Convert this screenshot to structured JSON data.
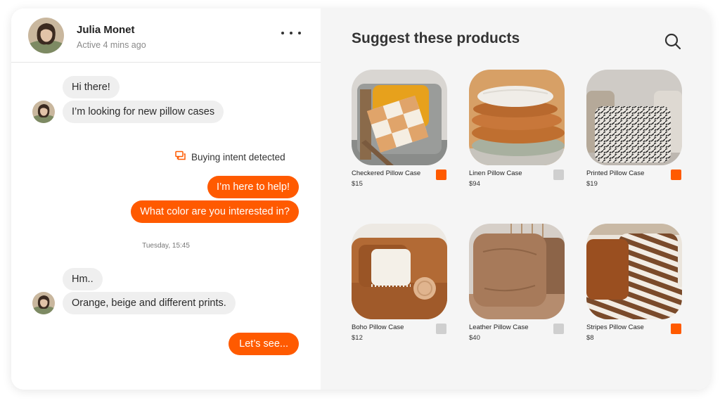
{
  "contact": {
    "name": "Julia Monet",
    "status": "Active 4 mins ago"
  },
  "messages": [
    {
      "from": "customer",
      "text": "Hi there!"
    },
    {
      "from": "customer",
      "text": "I’m looking for new pillow cases"
    },
    {
      "from": "agent",
      "text": "I’m here to help!"
    },
    {
      "from": "agent",
      "text": "What color are you interested in?"
    },
    {
      "from": "customer",
      "text": "Hm.."
    },
    {
      "from": "customer",
      "text": "Orange, beige and different prints."
    },
    {
      "from": "agent",
      "text": "Let’s see..."
    }
  ],
  "intent_label": "Buying intent detected",
  "timestamp": "Tuesday, 15:45",
  "panel": {
    "title": "Suggest these products"
  },
  "products": [
    {
      "name": "Checkered Pillow Case",
      "price": "$15",
      "swatch": "#ff5a00"
    },
    {
      "name": "Linen Pillow Case",
      "price": "$94",
      "swatch": "#cfcfcf"
    },
    {
      "name": "Printed Pillow Case",
      "price": "$19",
      "swatch": "#ff5a00"
    },
    {
      "name": "Boho Pillow Case",
      "price": "$12",
      "swatch": "#cfcfcf"
    },
    {
      "name": "Leather Pillow Case",
      "price": "$40",
      "swatch": "#cfcfcf"
    },
    {
      "name": "Stripes Pillow Case",
      "price": "$8",
      "swatch": "#ff5a00"
    }
  ],
  "colors": {
    "accent": "#ff5a00",
    "incoming_bubble": "#efefef",
    "panel_bg": "#f5f5f5"
  },
  "icons": {
    "more": "more-horizontal-icon",
    "intent": "chat-bubbles-icon",
    "search": "search-icon"
  }
}
